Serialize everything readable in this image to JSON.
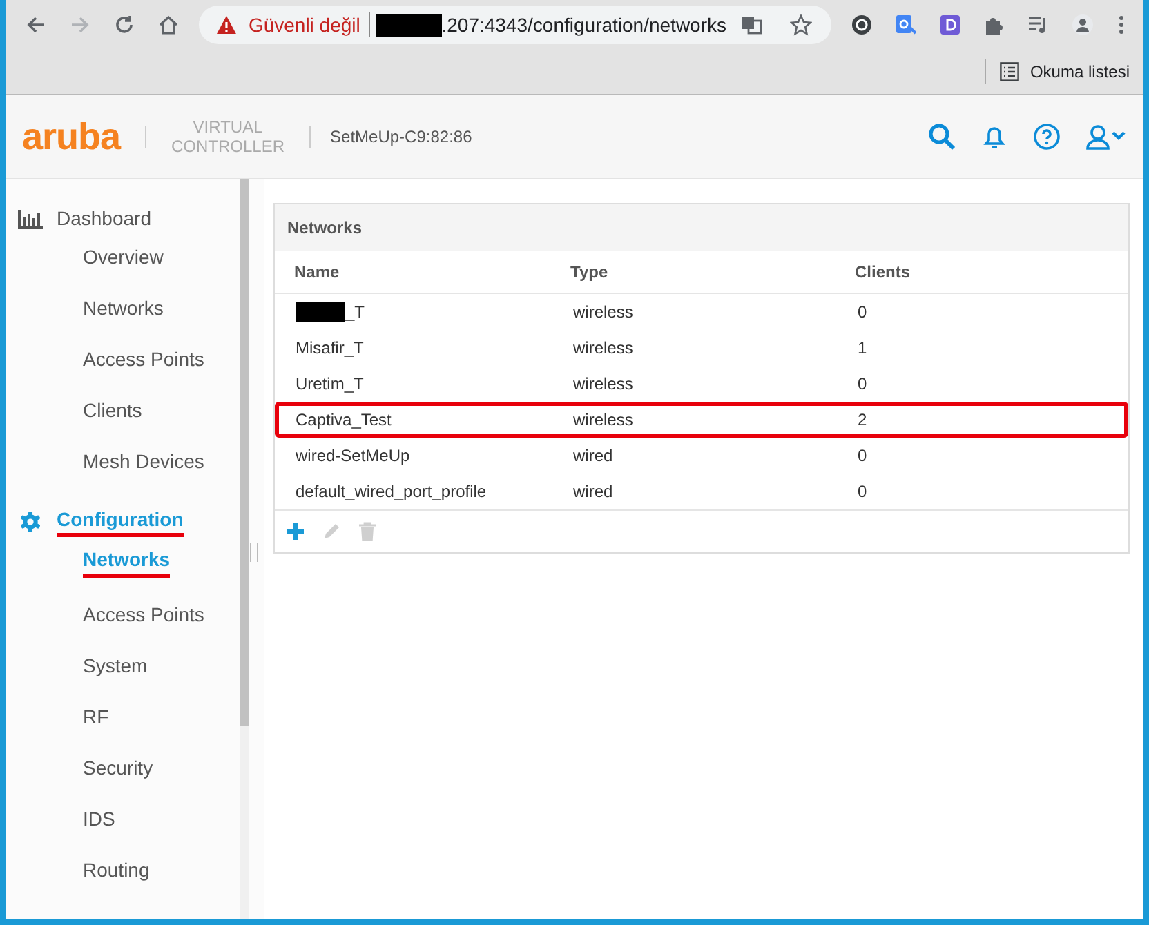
{
  "browser": {
    "security_label": "Güvenli değil",
    "url_redacted": true,
    "url": ".207:4343/configuration/networks",
    "reading_list": "Okuma listesi"
  },
  "header": {
    "logo": "aruba",
    "product": "VIRTUAL CONTROLLER",
    "device": "SetMeUp-C9:82:86"
  },
  "sidebar": {
    "groups": [
      {
        "kind": "dashboard",
        "label": "Dashboard",
        "selected": false,
        "underlined": false,
        "items": [
          {
            "label": "Overview",
            "selected": false,
            "underlined": false
          },
          {
            "label": "Networks",
            "selected": false,
            "underlined": false
          },
          {
            "label": "Access Points",
            "selected": false,
            "underlined": false
          },
          {
            "label": "Clients",
            "selected": false,
            "underlined": false
          },
          {
            "label": "Mesh Devices",
            "selected": false,
            "underlined": false
          }
        ]
      },
      {
        "kind": "configuration",
        "label": "Configuration",
        "selected": true,
        "underlined": true,
        "items": [
          {
            "label": "Networks",
            "selected": true,
            "underlined": true
          },
          {
            "label": "Access Points",
            "selected": false,
            "underlined": false
          },
          {
            "label": "System",
            "selected": false,
            "underlined": false
          },
          {
            "label": "RF",
            "selected": false,
            "underlined": false
          },
          {
            "label": "Security",
            "selected": false,
            "underlined": false
          },
          {
            "label": "IDS",
            "selected": false,
            "underlined": false
          },
          {
            "label": "Routing",
            "selected": false,
            "underlined": false
          }
        ]
      }
    ]
  },
  "networks": {
    "title": "Networks",
    "columns": [
      "Name",
      "Type",
      "Clients"
    ],
    "rows": [
      {
        "name": "_T",
        "name_redacted": true,
        "type": "wireless",
        "clients": "0",
        "highlighted": false
      },
      {
        "name": "Misafir_T",
        "name_redacted": false,
        "type": "wireless",
        "clients": "1",
        "highlighted": false
      },
      {
        "name": "Uretim_T",
        "name_redacted": false,
        "type": "wireless",
        "clients": "0",
        "highlighted": false
      },
      {
        "name": "Captiva_Test",
        "name_redacted": false,
        "type": "wireless",
        "clients": "2",
        "highlighted": true
      },
      {
        "name": "wired-SetMeUp",
        "name_redacted": false,
        "type": "wired",
        "clients": "0",
        "highlighted": false
      },
      {
        "name": "default_wired_port_profile",
        "name_redacted": false,
        "type": "wired",
        "clients": "0",
        "highlighted": false
      }
    ]
  }
}
